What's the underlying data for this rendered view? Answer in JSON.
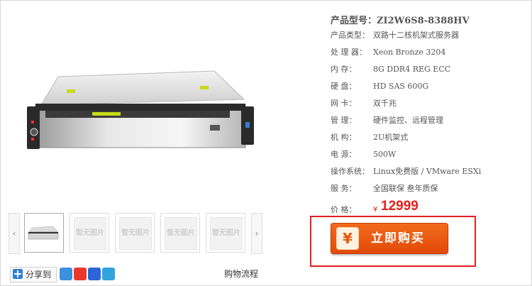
{
  "product": {
    "model_label": "产品型号：",
    "model_value": "ZI2W6S8-8388HV",
    "specs": [
      {
        "label": "产品类型：",
        "value": "双路十二核机架式服务器"
      },
      {
        "label": "处 理 器：",
        "value": "Xeon Bronze 3204"
      },
      {
        "label": "内    存：",
        "value": "8G DDR4 REG ECC"
      },
      {
        "label": "硬    盘：",
        "value": "HD SAS 600G"
      },
      {
        "label": "网    卡：",
        "value": "双千兆"
      },
      {
        "label": "管    理：",
        "value": "硬件监控、远程管理"
      },
      {
        "label": "机    构：",
        "value": "2U机架式"
      },
      {
        "label": "电    源：",
        "value": "500W"
      },
      {
        "label": "操作系统：",
        "value": "Linux免费版 / VMware ESXi"
      },
      {
        "label": "服    务：",
        "value": "全国联保 叁年质保"
      }
    ],
    "price_label": "价    格：",
    "currency": "¥",
    "price": "12999"
  },
  "gallery": {
    "prev": "‹",
    "next": "›",
    "placeholder_text": "暂无图片"
  },
  "buy": {
    "icon_glyph": "¥",
    "label": "立即购买"
  },
  "share": {
    "label": "分享到",
    "flow_link": "购物流程"
  },
  "colors": {
    "price_red": "#e4201b",
    "buy_orange": "#f26b1c",
    "highlight_border": "#e02020"
  }
}
